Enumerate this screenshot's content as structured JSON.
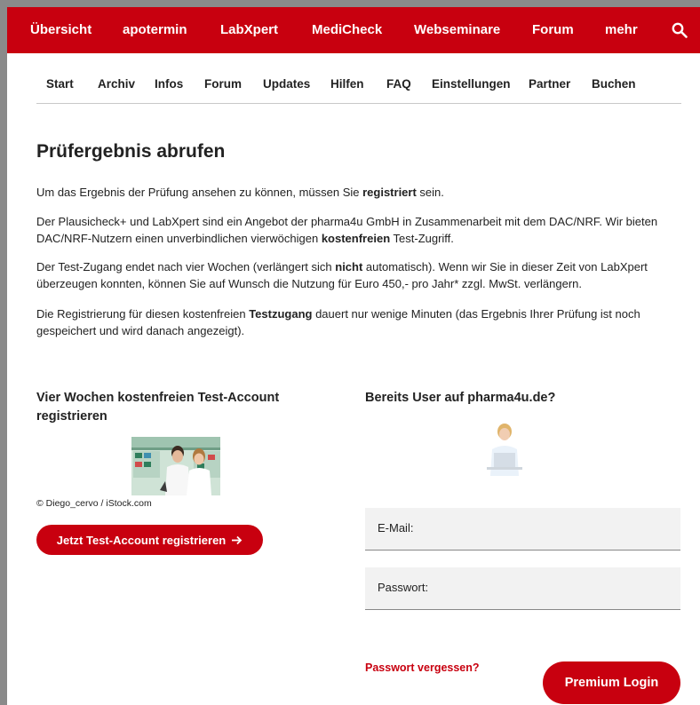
{
  "topnav": {
    "items": [
      "Übersicht",
      "apotermin",
      "LabXpert",
      "MediCheck",
      "Webseminare",
      "Forum",
      "mehr"
    ],
    "search_icon": "search-icon"
  },
  "subnav": {
    "items": [
      "Start",
      "Archiv",
      "Infos",
      "Forum",
      "Updates",
      "Hilfen",
      "FAQ",
      "Einstellungen",
      "Partner",
      "Buchen"
    ]
  },
  "main": {
    "title": "Prüfergebnis abrufen",
    "p1": {
      "a": "Um das Ergebnis der Prüfung ansehen zu können, müssen Sie ",
      "b": "registriert",
      "c": " sein."
    },
    "p2": {
      "a": "Der Plausicheck+ und LabXpert sind ein Angebot der pharma4u GmbH in Zusammenarbeit mit dem DAC/NRF. Wir bieten DAC/NRF-Nutzern einen unverbindlichen vierwöchigen ",
      "b": "kostenfreien",
      "c": " Test-Zugriff."
    },
    "p3": {
      "a": "Der Test-Zugang endet nach vier Wochen (verlängert sich ",
      "b": "nicht",
      "c": " automatisch). Wenn wir Sie in dieser Zeit von LabXpert überzeugen konnten, können Sie auf Wunsch die Nutzung für Euro 450,- pro Jahr* zzgl. MwSt. verlängern."
    },
    "p4": {
      "a": "Die Registrierung für diesen kostenfreien ",
      "b": "Testzugang",
      "c": " dauert nur wenige Minuten (das Ergebnis Ihrer Prüfung ist noch gespeichert und wird danach angezeigt)."
    }
  },
  "register": {
    "title": "Vier Wochen kostenfreien Test-Account registrieren",
    "credit": "© Diego_cervo / iStock.com",
    "button_label": "Jetzt Test-Account registrieren",
    "button_icon": "arrow-right-icon"
  },
  "login": {
    "title": "Bereits User auf pharma4u.de?",
    "email_label": "E-Mail:",
    "password_label": "Passwort:",
    "forgot_label": "Passwort vergessen?",
    "button_label": "Premium Login"
  },
  "colors": {
    "brand": "#c8000f"
  }
}
